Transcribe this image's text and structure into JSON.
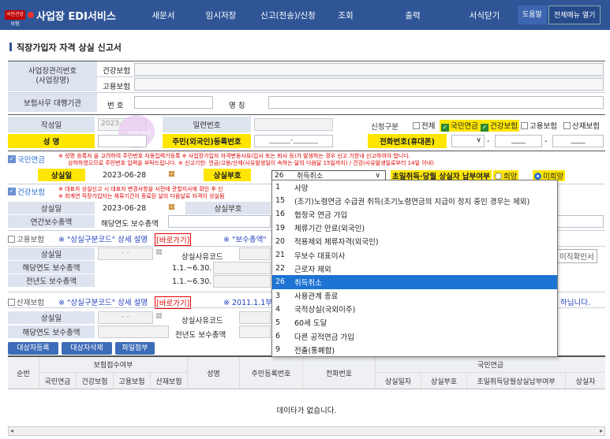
{
  "nav": {
    "logo": "국민건강보험",
    "title": "사업장 EDI서비스",
    "items": [
      "새문서",
      "임시저장",
      "신고(전송)/신청",
      "조회",
      "출력",
      "서식닫기"
    ],
    "help": "도움말",
    "all_menu": "전체메뉴 열기"
  },
  "page": {
    "title": "직장가입자 자격 상실 신고서"
  },
  "business": {
    "id_label": "사업장관리번호\n(사업장명)",
    "health": "건강보험",
    "employment": "고용보험",
    "agent_label": "보험사무 대행기관",
    "num_label": "번 호",
    "name_label": "명 칭"
  },
  "form": {
    "date_label": "작성일",
    "date_value": "2023-",
    "serial_label": "일련번호",
    "apply_label": "신청구분",
    "apply_all": "전체",
    "apply_pension": "국민연금",
    "apply_health": "건강보험",
    "apply_employ": "고용보험",
    "apply_accident": "산재보험",
    "name_label": "성 명",
    "rrn_label": "주민(외국인)등록번호",
    "rrn_value": "______-_______",
    "phone_label": "전화번호(휴대폰)",
    "phone_sep": "-",
    "phone_tail": "____",
    "stamp": "신청일자"
  },
  "pension": {
    "title": "국민연금",
    "notice1": "※ 성명 등록자 을 고려하여 주민번호 자동입력기등록 ※ 사업장가입자 자격변동사유(입사 또는 퇴사 등)가 발생하는 경우 신고 기한내 신고하여야 합니다.",
    "notice2": "상하하였으므로 주민번호 입력을 부탁드립니다. ※ 신고기한: 연금/고용/산재(사유발생일이 속하는 달의 다음달 15일까지) / 건강(사유발생일로부터 14일 이내)",
    "loss_date_label": "상실일",
    "loss_date": "2023-06-28",
    "loss_code_label": "상실부호",
    "selected_code": "26",
    "selected_text": "취득취소",
    "first_month_label": "초일취득·당월 상실자 납부여부",
    "wish": "희망",
    "no_wish": "미희망"
  },
  "health": {
    "title": "건강보험",
    "notice1": "※ 대표자 상실신고 시 대표자 변경사항을 사전에 관할지사에 확인 후 신",
    "notice2": "※ 회계연 직장가입자는 체류기간이 종료된 날의 다음날로 자격이 상실됨",
    "loss_date_label": "상실일",
    "loss_date": "2023-06-28",
    "loss_code_label": "상실부호",
    "annual_label": "연간보수총액",
    "year_label": "해당연도 보수총액"
  },
  "employ": {
    "title": "고용보험",
    "guide": "※ \"상실구분코드\" 상세 설명",
    "shortcut": "[바로가기]",
    "guide2": "※ \"보수총액\"",
    "loss_label": "상실일",
    "loss_value": "- -",
    "reason_label": "상실사유코드",
    "year_label": "해당연도 보수총액",
    "year_range": "1.1.~6.30.",
    "prev_label": "전년도 보수총액",
    "prev_range": "1.1.~6.30.",
    "confirm": "이직확인서"
  },
  "accident": {
    "title": "산재보험",
    "guide": "※ \"상실구분코드\" 상세 설명",
    "shortcut": "[바로가기]",
    "guide2": "※ 2011.1.1부터",
    "tail": "하닙니다.",
    "loss_label": "상실일",
    "loss_value": "- -",
    "reason_label": "상실사유코드",
    "year_label": "해당연도 보수총액",
    "prev_label": "전년도 보수총액"
  },
  "buttons": {
    "register": "대상자등록",
    "delete": "대상자삭제",
    "attach": "파일첨부"
  },
  "dropdown": [
    {
      "code": "1",
      "text": "사망"
    },
    {
      "code": "15",
      "text": "(조기)노령연금 수급권 취득(조기노령연금의 지급이 정지 중인 경우는 제외)"
    },
    {
      "code": "16",
      "text": "협정국 연금 가입"
    },
    {
      "code": "19",
      "text": "체류기간 만료(외국인)"
    },
    {
      "code": "20",
      "text": "적용제외 체류자격(외국인)"
    },
    {
      "code": "21",
      "text": "무보수 대표이사"
    },
    {
      "code": "22",
      "text": "근로자 제외"
    },
    {
      "code": "26",
      "text": "취득취소"
    },
    {
      "code": "3",
      "text": "사용관계 종료"
    },
    {
      "code": "4",
      "text": "국적상실(국외이주)"
    },
    {
      "code": "5",
      "text": "60세 도달"
    },
    {
      "code": "6",
      "text": "다른 공적연금 가입"
    },
    {
      "code": "9",
      "text": "전출(통폐합)"
    }
  ],
  "table": {
    "h_seq": "순번",
    "h_report": "보험접수여부",
    "h_name": "성명",
    "h_rrn": "주민등록번호",
    "h_phone": "전화번호",
    "h_pension": "국민연금",
    "sub": [
      "국민연금",
      "건강보험",
      "고용보험",
      "산재보험"
    ],
    "p_sub": [
      "상실일자",
      "상실부호",
      "초일취득당월상실납부여부",
      "상실자"
    ],
    "empty": "데이타가 없습니다."
  }
}
